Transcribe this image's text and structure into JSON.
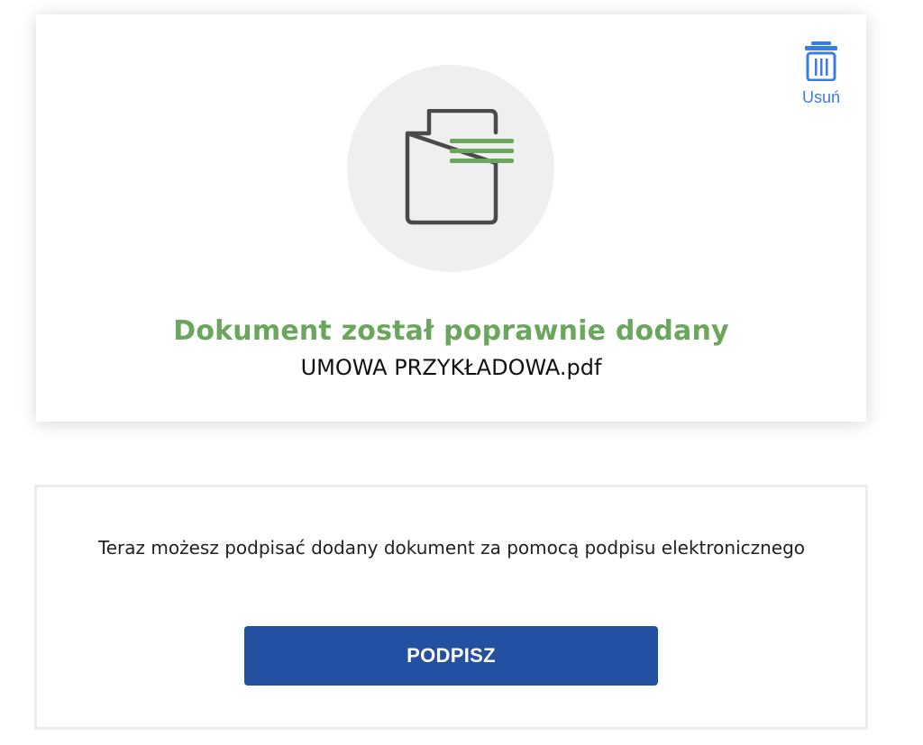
{
  "upload": {
    "delete_label": "Usuń",
    "delete_icon": "trash-icon",
    "document_icon": "document-icon",
    "success_message": "Dokument został poprawnie dodany",
    "file_name": "UMOWA PRZYKŁADOWA.pdf"
  },
  "sign": {
    "description": "Teraz możesz podpisać dodany dokument za pomocą podpisu elektronicznego",
    "button_label": "PODPISZ"
  },
  "colors": {
    "success_green": "#6aa65c",
    "primary_blue": "#2350a0",
    "link_blue": "#3a7de0",
    "circle_gray": "#efefef"
  }
}
